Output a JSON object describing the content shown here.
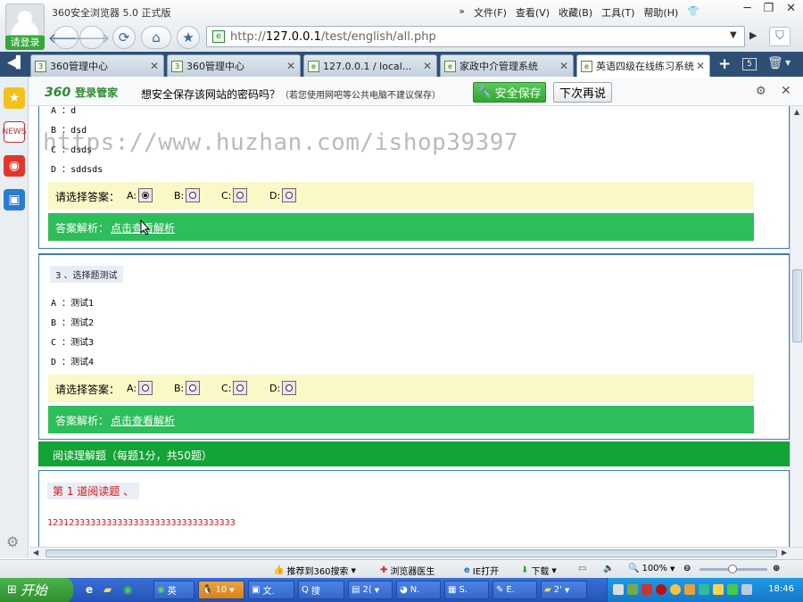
{
  "browser": {
    "title": "360安全浏览器 5.0 正式版",
    "login_label": "请登录",
    "menu": [
      "文件(F)",
      "查看(V)",
      "收藏(B)",
      "工具(T)",
      "帮助(H)"
    ],
    "address_prefix": "http://",
    "address_host": "127.0.0.1",
    "address_path": "/test/english/all.php",
    "tab_count_badge": "5"
  },
  "tabs": [
    {
      "label": "360管理中心"
    },
    {
      "label": "360管理中心"
    },
    {
      "label": "127.0.0.1 / local..."
    },
    {
      "label": "家政中介管理系统"
    },
    {
      "label": "英语四级在线练习系统"
    }
  ],
  "password_bar": {
    "logo_num": "360",
    "logo_text": "登录管家",
    "message": "想安全保存该网站的密码吗？",
    "note": "（若您使用网吧等公共电脑不建议保存）",
    "save_label": "安全保存",
    "later_label": "下次再说"
  },
  "watermark": "https://www.huzhan.com/ishop39397",
  "question2": {
    "options": [
      {
        "key": "A",
        "text": "d"
      },
      {
        "key": "B",
        "text": "dsd"
      },
      {
        "key": "C",
        "text": "dsds"
      },
      {
        "key": "D",
        "text": "sddsds"
      }
    ],
    "answer_label": "请选择答案：",
    "choices": [
      "A:",
      "B:",
      "C:",
      "D:"
    ],
    "selected": "A",
    "analysis_label": "答案解析：",
    "analysis_link": "点击查看解析"
  },
  "question3": {
    "title": "3 、选择题测试",
    "options": [
      {
        "key": "A",
        "text": "测试1"
      },
      {
        "key": "B",
        "text": "测试2"
      },
      {
        "key": "C",
        "text": "测试3"
      },
      {
        "key": "D",
        "text": "测试4"
      }
    ],
    "answer_label": "请选择答案：",
    "choices": [
      "A:",
      "B:",
      "C:",
      "D:"
    ],
    "analysis_label": "答案解析：",
    "analysis_link": "点击查看解析"
  },
  "reading_section": {
    "header": "阅读理解题（每题1分，共50题）",
    "question_title": "第 1 道阅读题 、",
    "content": "12312333333333333333333333333333333"
  },
  "statusbar": {
    "recommend": "推荐到360搜索",
    "doctor": "浏览器医生",
    "ie_open": "IE打开",
    "download": "下载",
    "zoom": "100%"
  },
  "taskbar": {
    "start_label": "开始",
    "items": [
      "英",
      "10",
      "文.",
      "搜",
      "2(",
      "N.",
      "S.",
      "E.",
      "2'"
    ],
    "clock": "18:46"
  }
}
